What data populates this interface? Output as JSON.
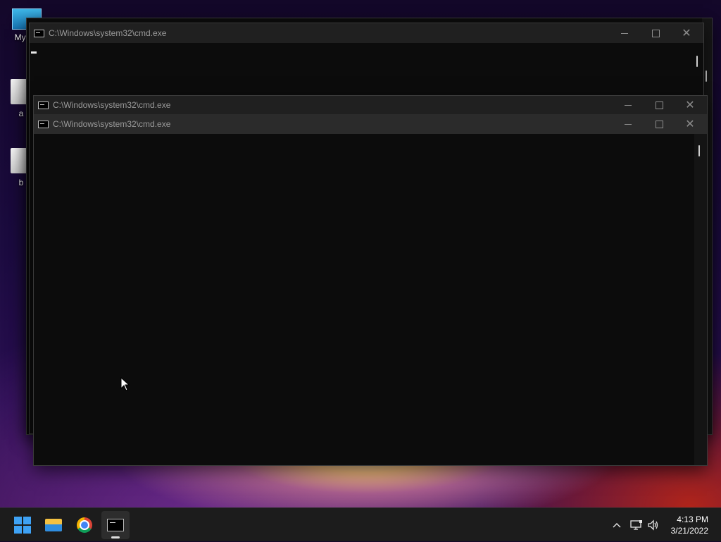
{
  "desktop": {
    "icons": [
      {
        "label": "My Co"
      },
      {
        "label": "a"
      },
      {
        "label": "b"
      }
    ]
  },
  "windows": {
    "back": {
      "title": "C:\\Windows\\system32\\cmd.exe"
    },
    "middle": {
      "title": "C:\\Windows\\system32\\cmd.exe"
    },
    "front": {
      "title": "C:\\Windows\\system32\\cmd.exe"
    }
  },
  "taskbar": {
    "apps": [
      {
        "name": "start-button"
      },
      {
        "name": "file-explorer"
      },
      {
        "name": "chrome"
      },
      {
        "name": "command-prompt",
        "active": true
      }
    ],
    "tray": {
      "chevron": "^"
    },
    "clock": {
      "time": "4:13 PM",
      "date": "3/21/2022"
    }
  }
}
